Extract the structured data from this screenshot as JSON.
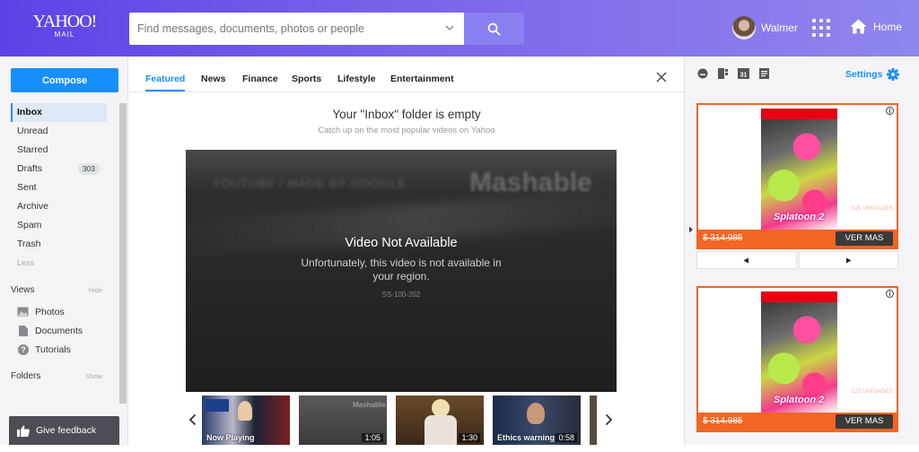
{
  "brand": {
    "name": "YAHOO!",
    "product": "MAIL"
  },
  "search": {
    "placeholder": "Find messages, documents, photos or people"
  },
  "user": {
    "name": "Walmer"
  },
  "header": {
    "home_label": "Home"
  },
  "sidebar": {
    "compose_label": "Compose",
    "folders": [
      {
        "label": "Inbox",
        "active": true
      },
      {
        "label": "Unread"
      },
      {
        "label": "Starred"
      },
      {
        "label": "Drafts",
        "count": "303"
      },
      {
        "label": "Sent"
      },
      {
        "label": "Archive"
      },
      {
        "label": "Spam"
      },
      {
        "label": "Trash"
      }
    ],
    "less_label": "Less",
    "views": {
      "title": "Views",
      "action": "Hide",
      "items": [
        {
          "label": "Photos",
          "icon": "photo-icon"
        },
        {
          "label": "Documents",
          "icon": "document-icon"
        },
        {
          "label": "Tutorials",
          "icon": "help-icon"
        }
      ]
    },
    "folders_section": {
      "title": "Folders",
      "action": "Show"
    },
    "feedback_label": "Give feedback"
  },
  "main": {
    "tabs": [
      {
        "label": "Featured",
        "active": true
      },
      {
        "label": "News"
      },
      {
        "label": "Finance"
      },
      {
        "label": "Sports"
      },
      {
        "label": "Lifestyle"
      },
      {
        "label": "Entertainment"
      }
    ],
    "empty_title": "Your \"Inbox\" folder is empty",
    "empty_subtitle": "Catch up on the most popular videos on Yahoo",
    "video": {
      "watermark_left": "YOUTUBE / MADE BY GOOGLE",
      "watermark_right": "Mashable",
      "title": "Video Not Available",
      "message": "Unfortunately, this video is not available in your region.",
      "error_code": "SS-100-202"
    },
    "thumbnails": [
      {
        "caption": "Now Playing",
        "duration": ""
      },
      {
        "caption": "",
        "duration": "1:05"
      },
      {
        "caption": "",
        "duration": "1:30"
      },
      {
        "caption": "Ethics warning",
        "duration": "0:58"
      }
    ]
  },
  "right_panel": {
    "settings_label": "Settings",
    "ads": [
      {
        "price": "$ 314.985",
        "button": "VER MAS",
        "note": "125 UNIDADES"
      },
      {
        "price": "$ 314.985",
        "button": "VER MAS",
        "note": "125 UNIDADES"
      }
    ]
  },
  "colors": {
    "accent": "#188fff",
    "header_start": "#5b43e8",
    "header_end": "#8f86ee",
    "ad_orange": "#f26522"
  }
}
